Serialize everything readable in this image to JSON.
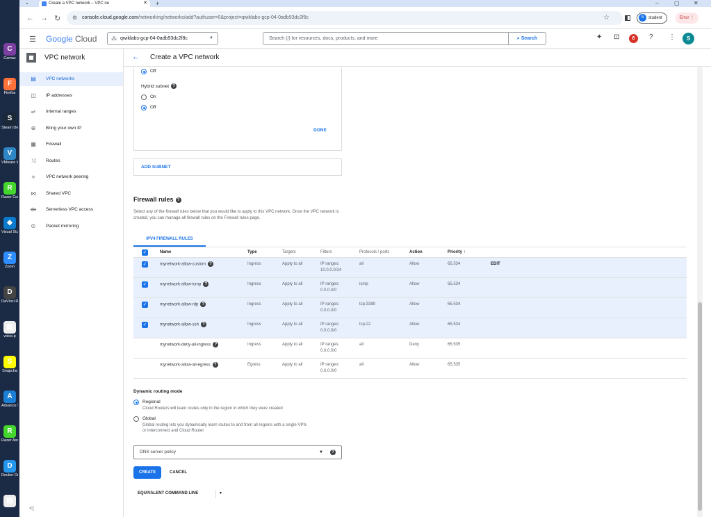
{
  "desktop_icons": [
    {
      "label": "Camac",
      "glyph": "C",
      "color": "#7b3fa0"
    },
    {
      "label": "Firefox",
      "glyph": "F",
      "color": "#ff7139"
    },
    {
      "label": "Steam De",
      "glyph": "S",
      "color": "#1b2838"
    },
    {
      "label": "VMware Workstati",
      "glyph": "V",
      "color": "#2f86c6"
    },
    {
      "label": "Razer Cort",
      "glyph": "R",
      "color": "#44d62c"
    },
    {
      "label": "Visual Stu Code",
      "glyph": "◆",
      "color": "#0a7acc"
    },
    {
      "label": "Zoom",
      "glyph": "Z",
      "color": "#2d8cff"
    },
    {
      "label": "DaVinci Resolve",
      "glyph": "D",
      "color": "#444"
    },
    {
      "label": "voice.p",
      "glyph": "▤",
      "color": "#eeeeee"
    },
    {
      "label": "Snapcha",
      "glyph": "S",
      "color": "#fffc00"
    },
    {
      "label": "Advance SystemC",
      "glyph": "A",
      "color": "#1c7fd6"
    },
    {
      "label": "Razer Axo",
      "glyph": "R",
      "color": "#44d62c"
    },
    {
      "label": "Docker Desktop",
      "glyph": "D",
      "color": "#2496ed"
    },
    {
      "label": "",
      "glyph": "▤",
      "color": "#eeeeee"
    }
  ],
  "browser": {
    "tab_title": "Create a VPC network – VPC ne",
    "url_host": "console.cloud.google.com",
    "url_path": "/networking/networks/add?authuser=0&project=qwiklabs-gcp-04-0adb93dc2f8c",
    "profile_name": "student",
    "profile_initial": "S",
    "error_label": "Error"
  },
  "header": {
    "logo_google": "Google",
    "logo_cloud": "Cloud",
    "project": "qwiklabs-gcp-04-0adb93dc2f8c",
    "search_placeholder": "Search (/) for resources, docs, products, and more",
    "search_button": "Search",
    "notification_count": "6",
    "avatar_initial": "S"
  },
  "sidebar": {
    "title": "VPC network",
    "items": [
      {
        "label": "VPC networks",
        "icon": "vpc-icon"
      },
      {
        "label": "IP addresses",
        "icon": "ip-icon"
      },
      {
        "label": "Internal ranges",
        "icon": "ranges-icon"
      },
      {
        "label": "Bring your own IP",
        "icon": "globe-icon"
      },
      {
        "label": "Firewall",
        "icon": "firewall-icon"
      },
      {
        "label": "Routes",
        "icon": "routes-icon"
      },
      {
        "label": "VPC network peering",
        "icon": "peering-icon"
      },
      {
        "label": "Shared VPC",
        "icon": "shared-icon"
      },
      {
        "label": "Serverless VPC access",
        "icon": "serverless-icon"
      },
      {
        "label": "Packet mirroring",
        "icon": "mirroring-icon"
      }
    ],
    "active_index": 0
  },
  "page": {
    "title": "Create a VPC network"
  },
  "subnet": {
    "top_option_label": "Off",
    "hybrid_label": "Hybrid subnet",
    "hybrid_on": "On",
    "hybrid_off": "Off",
    "done_label": "DONE",
    "add_subnet_label": "ADD SUBNET"
  },
  "firewall": {
    "title": "Firewall rules",
    "description": "Select any of the firewall rules below that you would like to apply to this VPC network. Once the VPC network is created, you can manage all firewall rules on the Firewall rules page.",
    "tab_label": "IPV4 FIREWALL RULES",
    "columns": [
      "Name",
      "Type",
      "Targets",
      "Filters",
      "Protocols / ports",
      "Action",
      "Priority"
    ],
    "edit_label": "EDIT",
    "rows": [
      {
        "name": "mynetwork-allow-custom",
        "type": "Ingress",
        "targets": "Apply to all",
        "filters": "IP ranges:",
        "filters2": "10.0.0.0/24",
        "protocols": "all",
        "action": "Allow",
        "priority": "65,534",
        "checked": true
      },
      {
        "name": "mynetwork-allow-icmp",
        "type": "Ingress",
        "targets": "Apply to all",
        "filters": "IP ranges:",
        "filters2": "0.0.0.0/0",
        "protocols": "icmp",
        "action": "Allow",
        "priority": "65,534",
        "checked": true
      },
      {
        "name": "mynetwork-allow-rdp",
        "type": "Ingress",
        "targets": "Apply to all",
        "filters": "IP ranges:",
        "filters2": "0.0.0.0/0",
        "protocols": "tcp:3389",
        "action": "Allow",
        "priority": "65,534",
        "checked": true
      },
      {
        "name": "mynetwork-allow-ssh",
        "type": "Ingress",
        "targets": "Apply to all",
        "filters": "IP ranges:",
        "filters2": "0.0.0.0/0",
        "protocols": "tcp:22",
        "action": "Allow",
        "priority": "65,534",
        "checked": true
      },
      {
        "name": "mynetwork-deny-all-ingress",
        "type": "Ingress",
        "targets": "Apply to all",
        "filters": "IP ranges:",
        "filters2": "0.0.0.0/0",
        "protocols": "all",
        "action": "Deny",
        "priority": "65,535",
        "checked": false
      },
      {
        "name": "mynetwork-allow-all-egress",
        "type": "Egress",
        "targets": "Apply to all",
        "filters": "IP ranges:",
        "filters2": "0.0.0.0/0",
        "protocols": "all",
        "action": "Allow",
        "priority": "65,535",
        "checked": false
      }
    ]
  },
  "routing": {
    "label": "Dynamic routing mode",
    "regional_label": "Regional",
    "regional_desc": "Cloud Routers will learn routes only in the region in which they were created",
    "global_label": "Global",
    "global_desc1": "Global routing lets you dynamically learn routes to and from all regions with a single VPN",
    "global_desc2": "or interconnect and Cloud Router"
  },
  "dns": {
    "placeholder": "DNS server policy"
  },
  "actions": {
    "create": "CREATE",
    "cancel": "CANCEL",
    "equivalent": "EQUIVALENT COMMAND LINE"
  }
}
